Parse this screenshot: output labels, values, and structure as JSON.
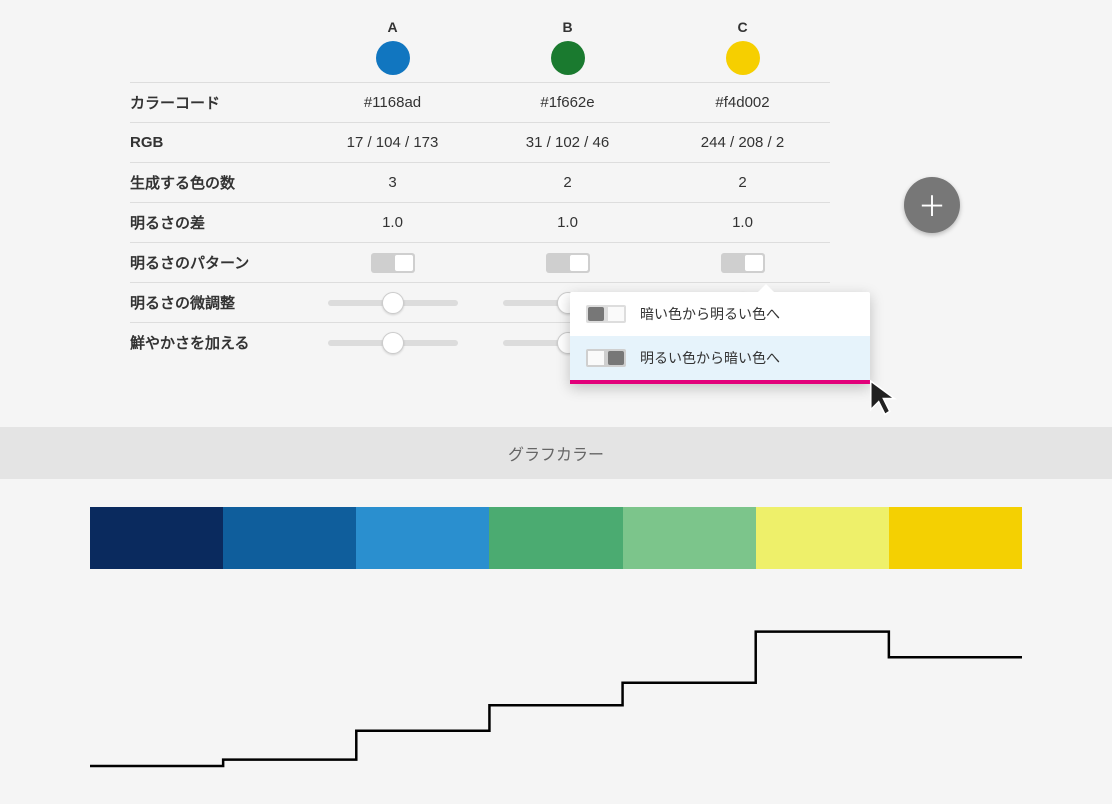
{
  "columns": [
    {
      "letter": "A",
      "hex": "#1168ad",
      "rgb": "17 / 104 / 173",
      "count": "3",
      "diff": "1.0",
      "swatch": "#1176c0"
    },
    {
      "letter": "B",
      "hex": "#1f662e",
      "rgb": "31 / 102 / 46",
      "count": "2",
      "diff": "1.0",
      "swatch": "#1a7a2f"
    },
    {
      "letter": "C",
      "hex": "#f4d002",
      "rgb": "244 / 208 / 2",
      "count": "2",
      "diff": "1.0",
      "swatch": "#f6cf00"
    }
  ],
  "labels": {
    "color_code": "カラーコード",
    "rgb": "RGB",
    "gen_count": "生成する色の数",
    "bright_diff": "明るさの差",
    "bright_pattern": "明るさのパターン",
    "bright_fine": "明るさの微調整",
    "vivid": "鮮やかさを加える"
  },
  "popover": {
    "opt1": "暗い色から明るい色へ",
    "opt2": "明るい色から暗い色へ"
  },
  "section_title": "グラフカラー",
  "palette": [
    "#0a2a5e",
    "#0f5e9c",
    "#2a8fcf",
    "#4bab71",
    "#7cc58b",
    "#eef06a",
    "#f4d002"
  ],
  "chart_data": {
    "type": "line",
    "title": "",
    "xlabel": "",
    "ylabel": "",
    "x": [
      0,
      1,
      2,
      3,
      4,
      5,
      6
    ],
    "values": [
      10,
      14,
      32,
      48,
      62,
      94,
      78
    ],
    "ylim": [
      0,
      100
    ],
    "note": "step chart showing relative lightness of the 7 palette colors"
  }
}
